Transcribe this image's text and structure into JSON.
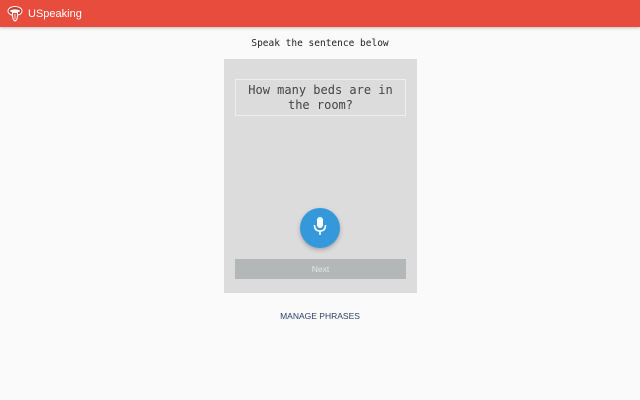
{
  "app": {
    "title": "USpeaking",
    "logo_icon": "tongue-lips-logo-icon",
    "bar_color": "#e74c3c"
  },
  "main": {
    "prompt": "Speak the sentence below",
    "sentence": "How many beds are in the room?",
    "mic_icon": "microphone-icon",
    "mic_color": "#3498db",
    "next_label": "Next",
    "manage_label": "MANAGE PHRASES"
  }
}
